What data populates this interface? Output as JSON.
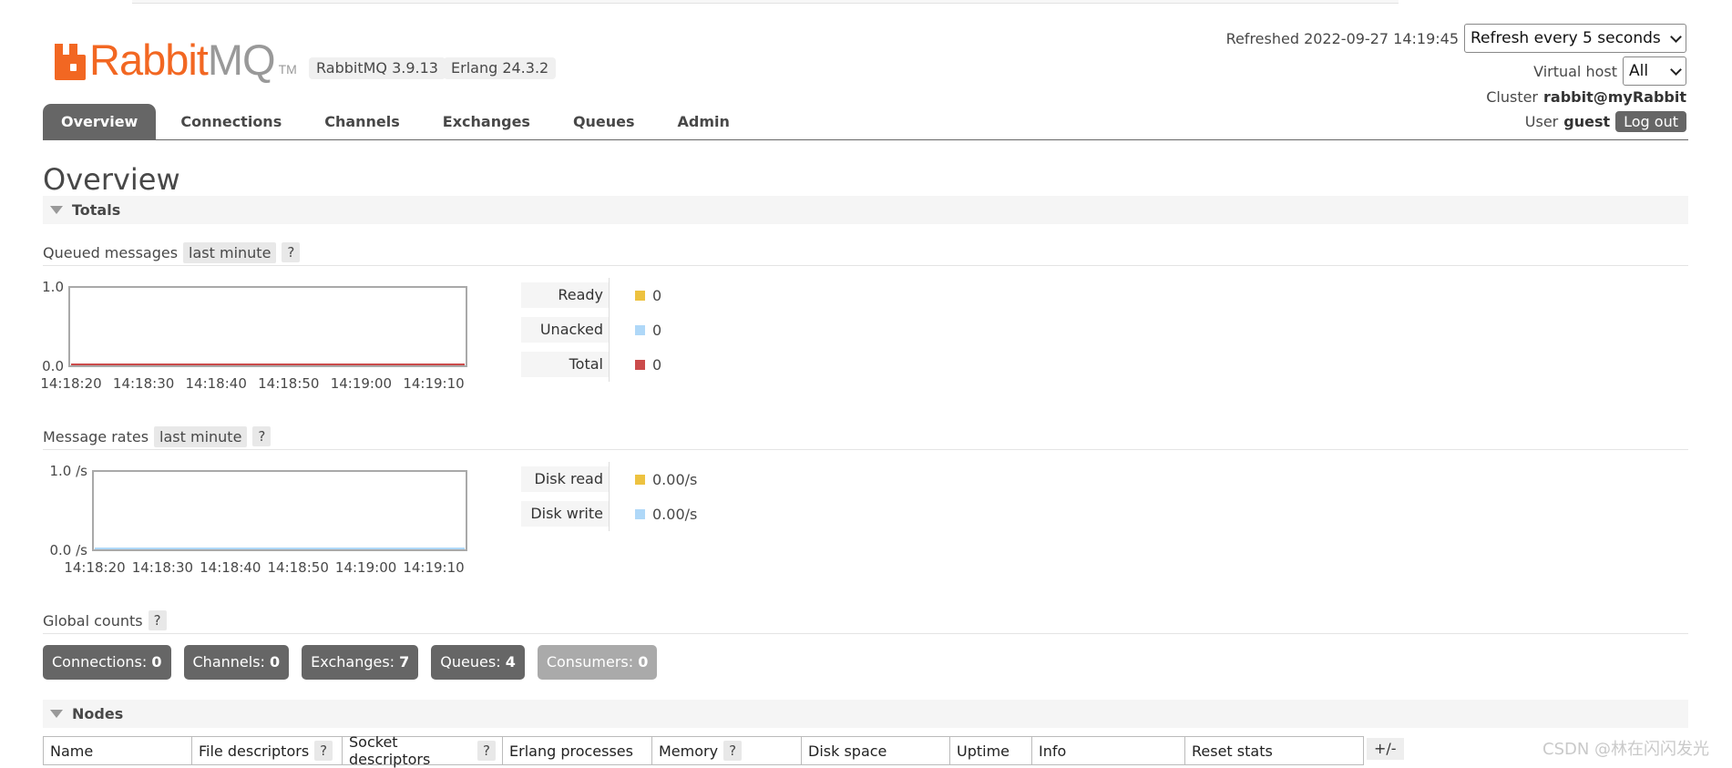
{
  "app": {
    "logo_text": "RabbitMQ",
    "logo_tm": "TM",
    "version": "RabbitMQ 3.9.13",
    "erlang": "Erlang 24.3.2",
    "brand_color": "#f26722"
  },
  "header": {
    "refreshed": "Refreshed 2022-09-27 14:19:45",
    "refresh_select": "Refresh every 5 seconds",
    "vhost_label": "Virtual host",
    "vhost_value": "All",
    "cluster_label": "Cluster",
    "cluster_value": "rabbit@myRabbit",
    "user_label": "User",
    "user_value": "guest",
    "logout": "Log out"
  },
  "tabs": [
    "Overview",
    "Connections",
    "Channels",
    "Exchanges",
    "Queues",
    "Admin"
  ],
  "page_title": "Overview",
  "totals": {
    "label": "Totals",
    "queued": {
      "title": "Queued messages",
      "range": "last minute",
      "help": "?",
      "legend": [
        {
          "label": "Ready",
          "value": "0",
          "color": "#edc240"
        },
        {
          "label": "Unacked",
          "value": "0",
          "color": "#afd8f8"
        },
        {
          "label": "Total",
          "value": "0",
          "color": "#cb4b4b"
        }
      ]
    },
    "rates": {
      "title": "Message rates",
      "range": "last minute",
      "help": "?",
      "legend": [
        {
          "label": "Disk read",
          "value": "0.00/s",
          "color": "#edc240"
        },
        {
          "label": "Disk write",
          "value": "0.00/s",
          "color": "#afd8f8"
        }
      ]
    }
  },
  "chart_data": [
    {
      "type": "line",
      "x": [
        "14:18:20",
        "14:18:30",
        "14:18:40",
        "14:18:50",
        "14:19:00",
        "14:19:10"
      ],
      "ylim": [
        0.0,
        1.0
      ],
      "y_tick_labels": [
        "1.0",
        "0.0"
      ],
      "series": [
        {
          "name": "Ready",
          "color": "#edc240",
          "values": [
            0,
            0,
            0,
            0,
            0,
            0
          ]
        },
        {
          "name": "Unacked",
          "color": "#afd8f8",
          "values": [
            0,
            0,
            0,
            0,
            0,
            0
          ]
        },
        {
          "name": "Total",
          "color": "#cb4b4b",
          "values": [
            0,
            0,
            0,
            0,
            0,
            0
          ]
        }
      ]
    },
    {
      "type": "line",
      "x": [
        "14:18:20",
        "14:18:30",
        "14:18:40",
        "14:18:50",
        "14:19:00",
        "14:19:10"
      ],
      "ylim": [
        0.0,
        1.0
      ],
      "y_tick_labels": [
        "1.0 /s",
        "0.0 /s"
      ],
      "series": [
        {
          "name": "Disk read",
          "color": "#edc240",
          "values": [
            0,
            0,
            0,
            0,
            0,
            0
          ]
        },
        {
          "name": "Disk write",
          "color": "#afd8f8",
          "values": [
            0,
            0,
            0,
            0,
            0,
            0
          ]
        }
      ]
    }
  ],
  "global_counts": {
    "title": "Global counts",
    "help": "?",
    "items": [
      {
        "label": "Connections:",
        "value": "0"
      },
      {
        "label": "Channels:",
        "value": "0"
      },
      {
        "label": "Exchanges:",
        "value": "7"
      },
      {
        "label": "Queues:",
        "value": "4"
      },
      {
        "label": "Consumers:",
        "value": "0"
      }
    ]
  },
  "nodes": {
    "label": "Nodes",
    "columns": [
      {
        "label": "Name",
        "help": ""
      },
      {
        "label": "File descriptors",
        "help": "?"
      },
      {
        "label": "Socket descriptors",
        "help": "?"
      },
      {
        "label": "Erlang processes",
        "help": ""
      },
      {
        "label": "Memory",
        "help": "?"
      },
      {
        "label": "Disk space",
        "help": ""
      },
      {
        "label": "Uptime",
        "help": ""
      },
      {
        "label": "Info",
        "help": ""
      },
      {
        "label": "Reset stats",
        "help": ""
      }
    ],
    "toggle": "+/-"
  },
  "watermark": "CSDN @林在闪闪发光"
}
